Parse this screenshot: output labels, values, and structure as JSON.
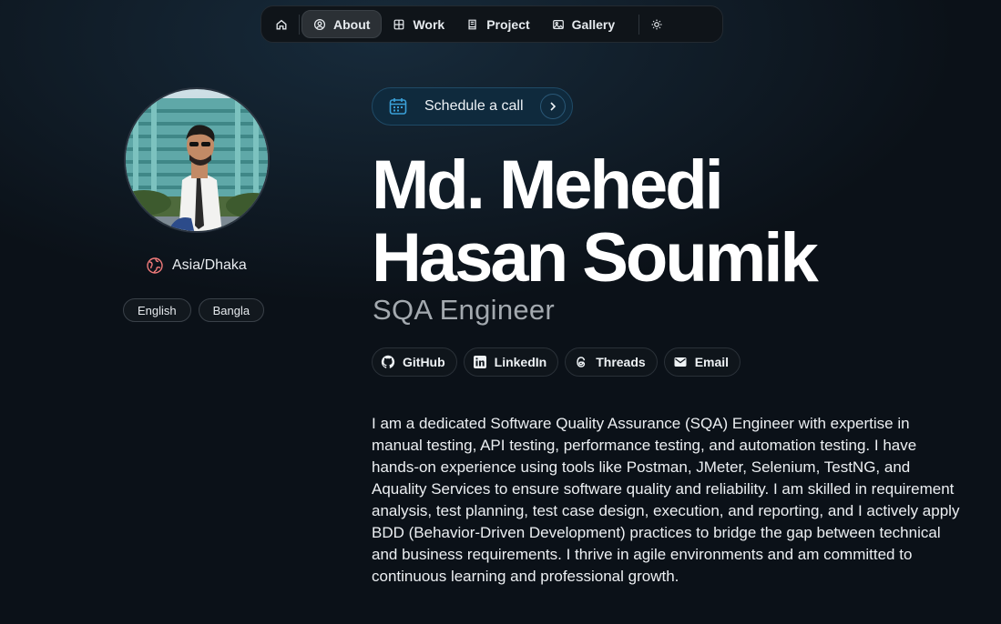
{
  "nav": {
    "items": [
      {
        "label": "About",
        "icon": "person-circle-icon",
        "active": true
      },
      {
        "label": "Work",
        "icon": "grid-icon"
      },
      {
        "label": "Project",
        "icon": "book-icon"
      },
      {
        "label": "Gallery",
        "icon": "image-icon"
      }
    ],
    "home_icon": "home-icon",
    "theme_icon": "sun-icon"
  },
  "profile": {
    "avatar_icon": "profile-photo",
    "location": "Asia/Dhaka",
    "languages": [
      "English",
      "Bangla"
    ]
  },
  "schedule": {
    "label": "Schedule a call",
    "icon": "calendar-icon"
  },
  "hero": {
    "name_line1": "Md. Mehedi",
    "name_line2": "Hasan Soumik",
    "role": "SQA Engineer"
  },
  "social": [
    {
      "label": "GitHub",
      "icon": "github-icon"
    },
    {
      "label": "LinkedIn",
      "icon": "linkedin-icon"
    },
    {
      "label": "Threads",
      "icon": "threads-icon"
    },
    {
      "label": "Email",
      "icon": "mail-icon"
    }
  ],
  "bio": "I am a dedicated Software Quality Assurance (SQA) Engineer with expertise in manual testing, API testing, performance testing, and automation testing. I have hands-on experience using tools like Postman, JMeter, Selenium, TestNG, and Aquality Services to ensure software quality and reliability. I am skilled in requirement analysis, test planning, test case design, execution, and reporting, and I actively apply BDD (Behavior-Driven Development) practices to bridge the gap between technical and business requirements. I thrive in agile environments and am committed to continuous learning and professional growth.",
  "colors": {
    "background": "#0b1118",
    "accent": "#0f2a3d",
    "calendar": "#3aa0d8",
    "location_icon": "#f07a7a"
  }
}
